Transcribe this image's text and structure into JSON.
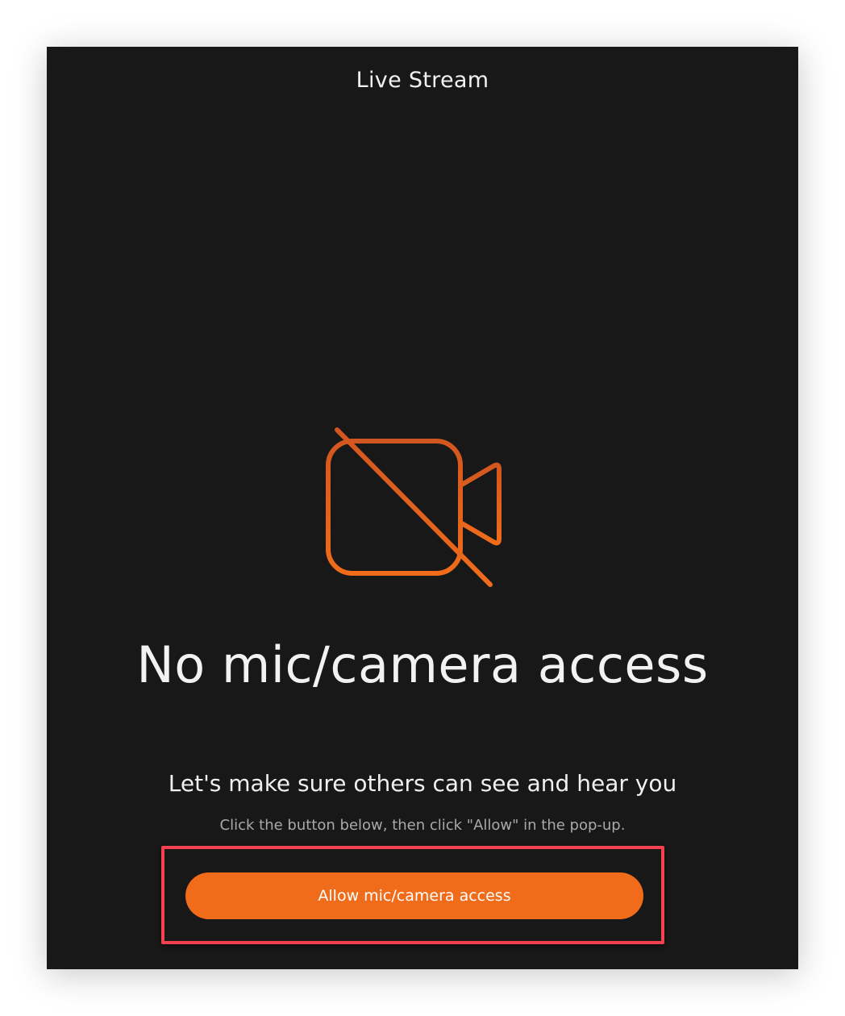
{
  "window": {
    "title": "Live Stream"
  },
  "main": {
    "icon": "camera-off-icon",
    "heading": "No mic/camera access",
    "subheading": "Let's make sure others can see and hear you",
    "hint": "Click the button below, then click \"Allow\" in the pop-up.",
    "allow_button_label": "Allow mic/camera access"
  },
  "colors": {
    "panel_background": "#181818",
    "accent": "#f06c1b",
    "icon_gradient_start": "#d2561f",
    "icon_gradient_end": "#f06c1b",
    "highlight_border": "#f4404f",
    "text_primary": "#f2f2f2",
    "text_secondary": "#a9a9a9"
  }
}
